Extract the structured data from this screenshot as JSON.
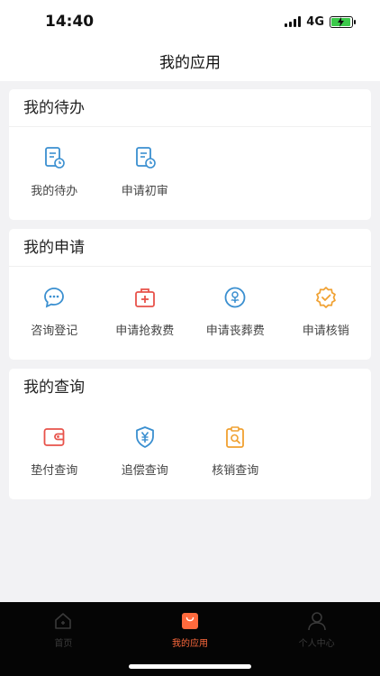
{
  "status_bar": {
    "time": "14:40",
    "network": "4G"
  },
  "header": {
    "title": "我的应用"
  },
  "sections": [
    {
      "title": "我的待办",
      "items": [
        {
          "label": "我的待办",
          "icon": "document-clock-icon",
          "color": "#3a8fd0"
        },
        {
          "label": "申请初审",
          "icon": "document-clock-icon",
          "color": "#3a8fd0"
        }
      ]
    },
    {
      "title": "我的申请",
      "items": [
        {
          "label": "咨询登记",
          "icon": "chat-bubble-icon",
          "color": "#3a8fd0"
        },
        {
          "label": "申请抢救费",
          "icon": "first-aid-kit-icon",
          "color": "#e8524a"
        },
        {
          "label": "申请丧葬费",
          "icon": "flower-circle-icon",
          "color": "#3a8fd0"
        },
        {
          "label": "申请核销",
          "icon": "check-badge-icon",
          "color": "#f0a030"
        }
      ]
    },
    {
      "title": "我的查询",
      "items": [
        {
          "label": "垫付查询",
          "icon": "wallet-icon",
          "color": "#e8524a"
        },
        {
          "label": "追偿查询",
          "icon": "yen-shield-icon",
          "color": "#3a8fd0"
        },
        {
          "label": "核销查询",
          "icon": "clipboard-search-icon",
          "color": "#f0a030"
        }
      ]
    }
  ],
  "tab_bar": {
    "tabs": [
      {
        "label": "首页",
        "icon": "home-icon",
        "active": false
      },
      {
        "label": "我的应用",
        "icon": "shopping-bag-icon",
        "active": true
      },
      {
        "label": "个人中心",
        "icon": "person-icon",
        "active": false
      }
    ],
    "active_color": "#ff6a3d"
  }
}
